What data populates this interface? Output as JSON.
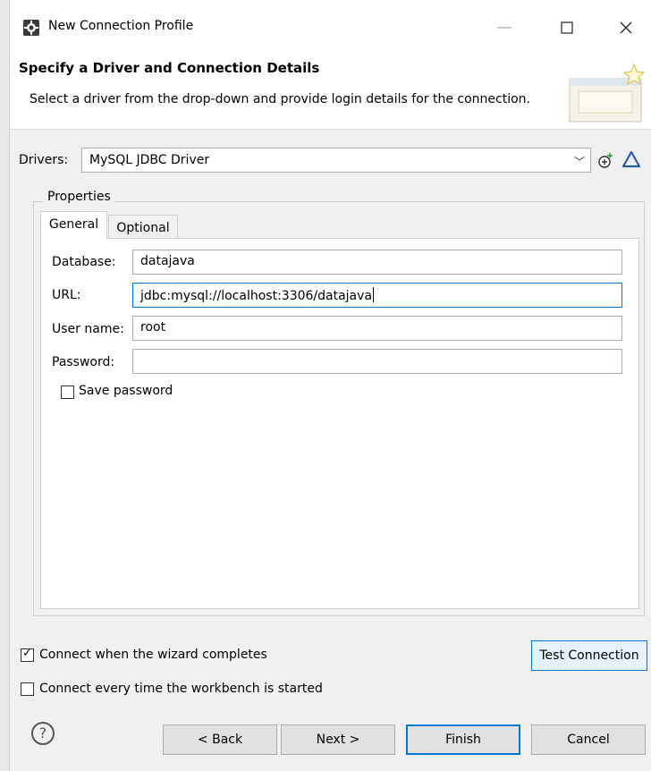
{
  "window": {
    "title": "New Connection Profile",
    "minimize_icon": "minimize-icon",
    "maximize_icon": "maximize-icon",
    "close_icon": "close-icon"
  },
  "header": {
    "title": "Specify a Driver and Connection Details",
    "description": "Select a driver from the drop-down and provide login details for the connection."
  },
  "drivers": {
    "label": "Drivers:",
    "selected": "MySQL JDBC Driver"
  },
  "properties": {
    "legend": "Properties",
    "tabs": [
      "General",
      "Optional"
    ],
    "active_tab": "General",
    "fields": {
      "database": {
        "label": "Database:",
        "value": "datajava"
      },
      "url": {
        "label": "URL:",
        "value": "jdbc:mysql://localhost:3306/datajava"
      },
      "user_name": {
        "label": "User name:",
        "value": "root"
      },
      "password": {
        "label": "Password:",
        "value": ""
      }
    },
    "save_password": {
      "label": "Save password",
      "checked": false
    }
  },
  "options": {
    "connect_when_completes": {
      "label": "Connect when the wizard completes",
      "checked": true
    },
    "connect_every_time": {
      "label": "Connect every time the workbench is started",
      "checked": false
    }
  },
  "buttons": {
    "test_connection": "Test Connection",
    "back": "< Back",
    "next": "Next >",
    "finish": "Finish",
    "cancel": "Cancel"
  },
  "colors": {
    "accent": "#0078d7",
    "edit_driver_icon": "#1f5fa8"
  }
}
